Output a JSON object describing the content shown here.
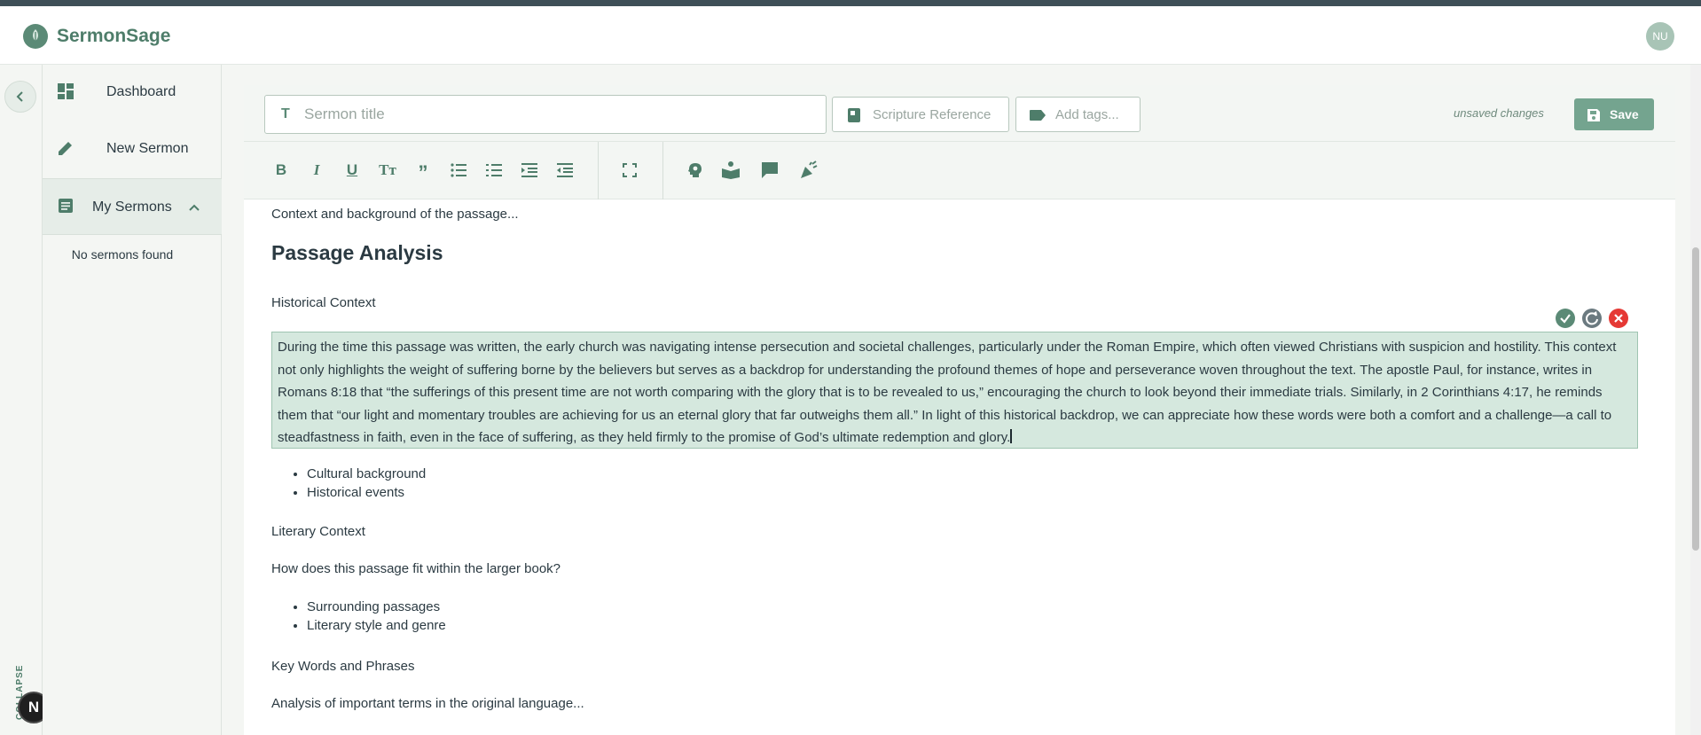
{
  "app": {
    "brand": "SermonSage",
    "avatar_initials": "NU"
  },
  "sidebar": {
    "items": [
      {
        "label": "Dashboard",
        "icon": "dashboard-icon"
      },
      {
        "label": "New Sermon",
        "icon": "pencil-icon"
      },
      {
        "label": "My Sermons",
        "icon": "document-list-icon"
      }
    ],
    "empty_text": "No sermons found",
    "collapse_label": "COLLAPSE",
    "badge": "N"
  },
  "editor": {
    "title_placeholder": "Sermon title",
    "scripture_placeholder": "Scripture Reference",
    "tags_placeholder": "Add tags...",
    "status": "unsaved changes",
    "save_label": "Save",
    "toolbar": [
      "bold",
      "italic",
      "underline",
      "text-size",
      "blockquote",
      "bullet-list",
      "numbered-list",
      "indent",
      "outdent",
      "fullscreen",
      "insight",
      "study",
      "comment",
      "celebrate"
    ]
  },
  "content": {
    "p0": "Context and background of the passage...",
    "h_analysis": "Passage Analysis",
    "historical": "Historical Context",
    "highlight_text": "During the time this passage was written, the early church was navigating intense persecution and societal challenges, particularly under the Roman Empire, which often viewed Christians with suspicion and hostility. This context not only highlights the weight of suffering borne by the believers but serves as a backdrop for understanding the profound themes of hope and perseverance woven throughout the text. The apostle Paul, for instance, writes in Romans 8:18 that “the sufferings of this present time are not worth comparing with the glory that is to be revealed to us,” encouraging the church to look beyond their immediate trials. Similarly, in 2 Corinthians 4:17, he reminds them that “our light and momentary troubles are achieving for us an eternal glory that far outweighs them all.” In light of this historical backdrop, we can appreciate how these words were both a comfort and a challenge—a call to steadfastness in faith, even in the face of suffering, as they held firmly to the promise of God’s ultimate redemption and glory.",
    "list1": [
      "Cultural background",
      "Historical events"
    ],
    "literary": "Literary Context",
    "literary_q": "How does this passage fit within the larger book?",
    "list2": [
      "Surrounding passages",
      "Literary style and genre"
    ],
    "keywords": "Key Words and Phrases",
    "keywords_desc": "Analysis of important terms in the original language..."
  },
  "colors": {
    "accent": "#4e7d6a",
    "save_button": "#74a48f",
    "highlight": "#d5e8de",
    "accept": "#5b8a76",
    "regenerate": "#6b7a80",
    "reject": "#e53935"
  }
}
